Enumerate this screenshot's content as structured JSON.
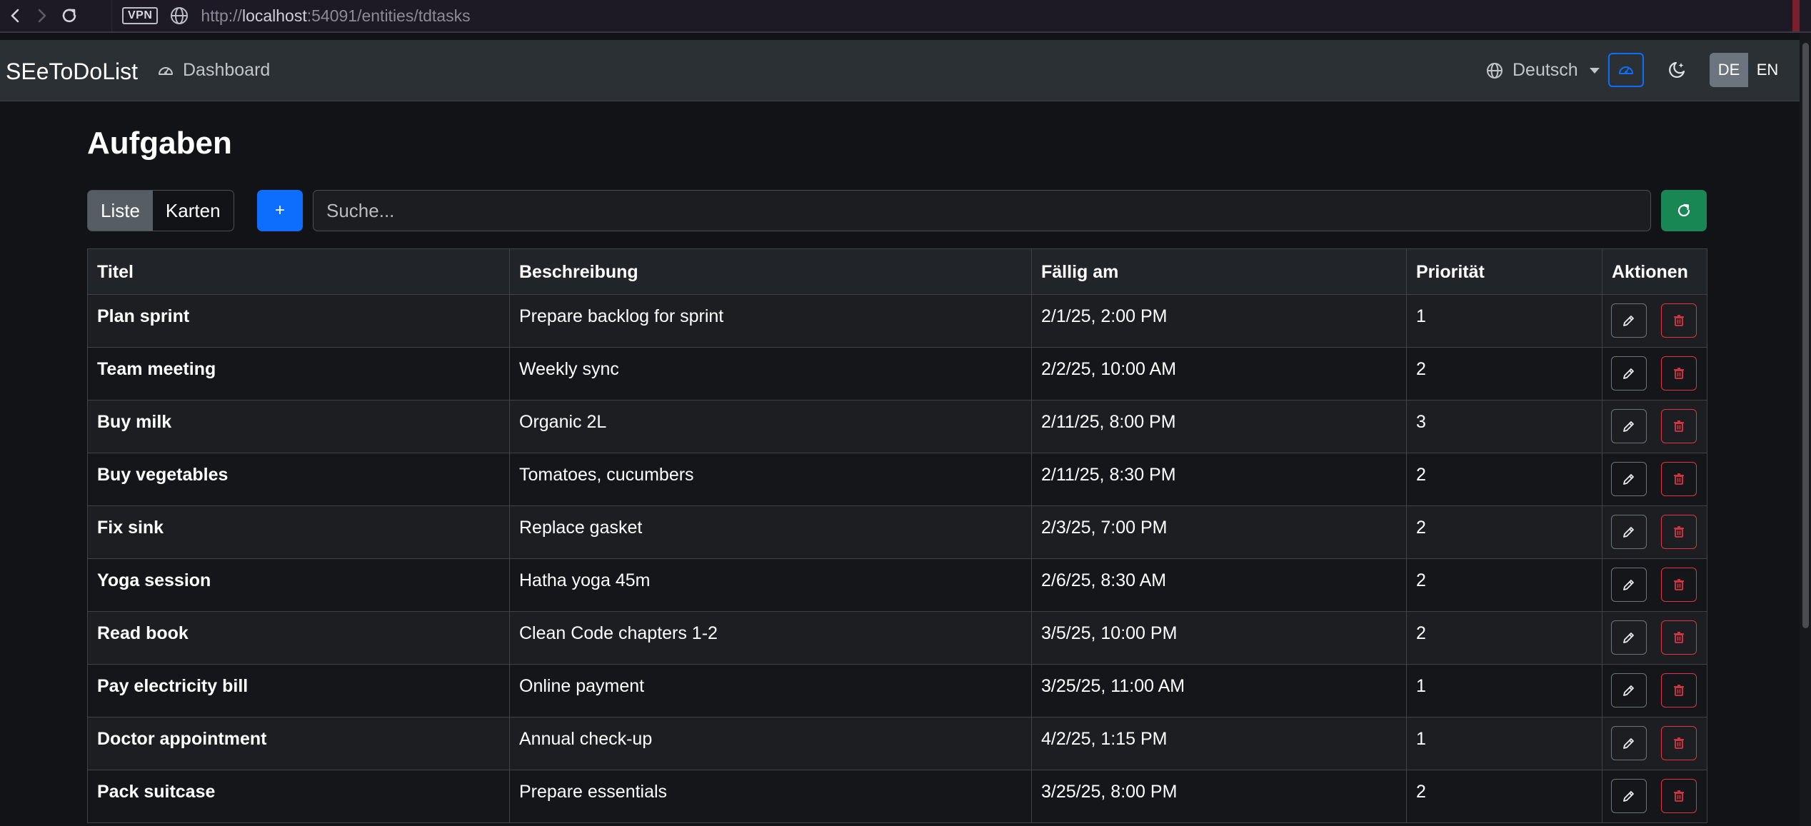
{
  "browser": {
    "vpn_label": "VPN",
    "url_prefix": "http://",
    "url_host": "localhost",
    "url_rest": ":54091/entities/tdtasks"
  },
  "navbar": {
    "brand": "SEeToDoList",
    "dashboard_label": "Dashboard",
    "language_label": "Deutsch",
    "lang_de": "DE",
    "lang_en": "EN"
  },
  "page": {
    "title": "Aufgaben",
    "view_list": "Liste",
    "view_cards": "Karten",
    "add_label": "+",
    "search_placeholder": "Suche..."
  },
  "table": {
    "headers": [
      "Titel",
      "Beschreibung",
      "Fällig am",
      "Priorität",
      "Aktionen"
    ],
    "rows": [
      {
        "title": "Plan sprint",
        "description": "Prepare backlog for sprint",
        "due": "2/1/25, 2:00 PM",
        "priority": "1"
      },
      {
        "title": "Team meeting",
        "description": "Weekly sync",
        "due": "2/2/25, 10:00 AM",
        "priority": "2"
      },
      {
        "title": "Buy milk",
        "description": "Organic 2L",
        "due": "2/11/25, 8:00 PM",
        "priority": "3"
      },
      {
        "title": "Buy vegetables",
        "description": "Tomatoes, cucumbers",
        "due": "2/11/25, 8:30 PM",
        "priority": "2"
      },
      {
        "title": "Fix sink",
        "description": "Replace gasket",
        "due": "2/3/25, 7:00 PM",
        "priority": "2"
      },
      {
        "title": "Yoga session",
        "description": "Hatha yoga 45m",
        "due": "2/6/25, 8:30 AM",
        "priority": "2"
      },
      {
        "title": "Read book",
        "description": "Clean Code chapters 1-2",
        "due": "3/5/25, 10:00 PM",
        "priority": "2"
      },
      {
        "title": "Pay electricity bill",
        "description": "Online payment",
        "due": "3/25/25, 11:00 AM",
        "priority": "1"
      },
      {
        "title": "Doctor appointment",
        "description": "Annual check-up",
        "due": "4/2/25, 1:15 PM",
        "priority": "1"
      },
      {
        "title": "Pack suitcase",
        "description": "Prepare essentials",
        "due": "3/25/25, 8:00 PM",
        "priority": "2"
      }
    ]
  },
  "colors": {
    "primary": "#0d6efd",
    "success": "#198754",
    "danger": "#dc3545",
    "navbar_bg": "#2b3035",
    "body_bg": "#121316"
  }
}
